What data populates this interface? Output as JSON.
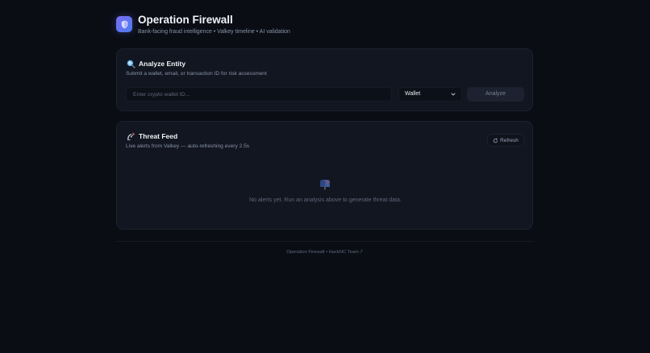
{
  "header": {
    "title": "Operation Firewall",
    "subtitle": "Bank-facing fraud intelligence • Valkey timeline • AI validation"
  },
  "analyze": {
    "icon": "magnifier-icon",
    "title": "Analyze Entity",
    "description": "Submit a wallet, email, or transaction ID for risk assessment",
    "input_value": "",
    "input_placeholder": "Enter crypto wallet ID...",
    "entity_type_selected": "Wallet",
    "analyze_label": "Analyze"
  },
  "feed": {
    "icon": "satellite-icon",
    "title": "Threat Feed",
    "description": "Live alerts from Valkey — auto-refreshing every 2.5s",
    "refresh_label": "Refresh",
    "empty_icon": "mailbox-icon",
    "empty_message": "No alerts yet. Run an analysis above to generate threat data."
  },
  "footer": {
    "text": "Operation Firewall • HackNC Team 7"
  },
  "colors": {
    "background": "#0a0d14",
    "panel": "#111620",
    "accent": "#6f74f2",
    "muted_text": "#8a93a6"
  }
}
